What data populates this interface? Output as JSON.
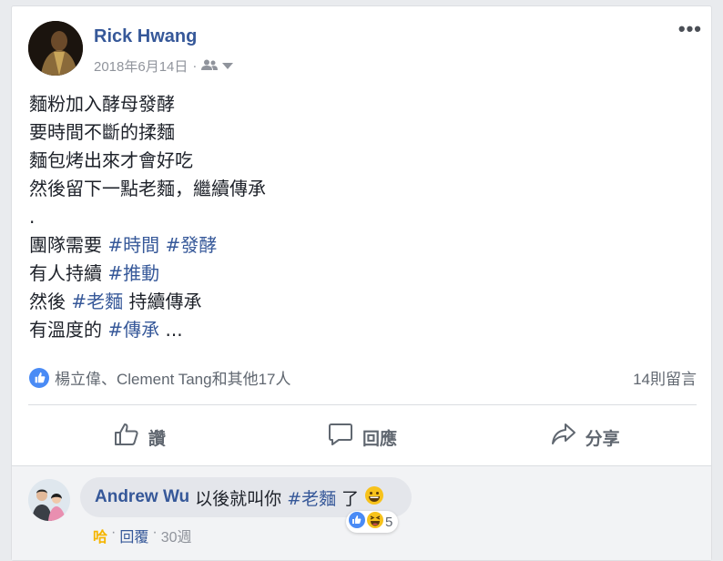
{
  "post": {
    "author": "Rick Hwang",
    "date": "2018年6月14日",
    "audience_icon": "friends-icon",
    "lines": [
      [
        {
          "text": "麵粉加入酵母發酵"
        }
      ],
      [
        {
          "text": "要時間不斷的揉麵"
        }
      ],
      [
        {
          "text": "麵包烤出來才會好吃"
        }
      ],
      [
        {
          "text": "然後留下一點老麵，繼續傳承"
        }
      ],
      [
        {
          "text": "."
        }
      ],
      [
        {
          "text": "團隊需要 "
        },
        {
          "text": "#時間",
          "tag": true
        },
        {
          "text": " "
        },
        {
          "text": "#發酵",
          "tag": true
        }
      ],
      [
        {
          "text": "有人持續 "
        },
        {
          "text": "#推動",
          "tag": true
        }
      ],
      [
        {
          "text": "然後 "
        },
        {
          "text": "#老麵",
          "tag": true
        },
        {
          "text": " 持續傳承"
        }
      ],
      [
        {
          "text": "有溫度的 "
        },
        {
          "text": "#傳承",
          "tag": true
        },
        {
          "text": " ..."
        }
      ]
    ]
  },
  "reactions": {
    "summary": "楊立偉、Clement Tang和其他17人",
    "comments_count": "14則留言"
  },
  "actions": {
    "like": "讚",
    "comment": "回應",
    "share": "分享"
  },
  "comment": {
    "author": "Andrew Wu",
    "text_before": "以後就叫你 ",
    "hashtag": "#老麵",
    "text_after": " 了",
    "emoji": "😀",
    "reaction_count": "5",
    "like_label": "哈",
    "sep1": "·",
    "reply_label": "回覆",
    "sep2": "·",
    "time": "30週"
  },
  "colors": {
    "link": "#365899",
    "like_blue": "#4a8bf5",
    "haha_yellow": "#f5b500"
  }
}
